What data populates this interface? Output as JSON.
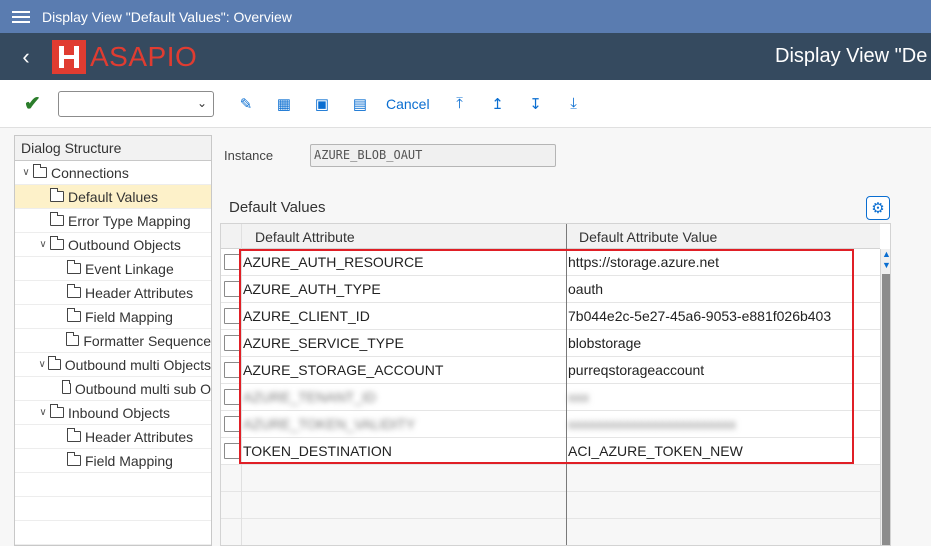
{
  "window": {
    "title": "Display View \"Default Values\": Overview"
  },
  "header": {
    "logo_text": "ASAPIO",
    "page_title": "Display View \"De"
  },
  "toolbar": {
    "cancel_label": "Cancel",
    "dropdown_value": ""
  },
  "tree": {
    "title": "Dialog Structure",
    "items": [
      {
        "label": "Connections",
        "level": 0,
        "expanded": true
      },
      {
        "label": "Default Values",
        "level": 1,
        "selected": true
      },
      {
        "label": "Error Type Mapping",
        "level": 1
      },
      {
        "label": "Outbound  Objects",
        "level": 1,
        "expanded": true
      },
      {
        "label": "Event Linkage",
        "level": 2
      },
      {
        "label": "Header Attributes",
        "level": 2
      },
      {
        "label": "Field Mapping",
        "level": 2
      },
      {
        "label": "Formatter Sequence",
        "level": 2
      },
      {
        "label": "Outbound multi Objects",
        "level": 1,
        "expanded": true
      },
      {
        "label": "Outbound multi sub O",
        "level": 2
      },
      {
        "label": "Inbound Objects",
        "level": 1,
        "expanded": true
      },
      {
        "label": "Header Attributes",
        "level": 2
      },
      {
        "label": "Field Mapping",
        "level": 2
      }
    ]
  },
  "instance": {
    "label": "Instance",
    "value": "AZURE_BLOB_OAUT"
  },
  "section": {
    "title": "Default Values"
  },
  "table": {
    "columns": [
      "Default Attribute",
      "Default Attribute Value"
    ],
    "rows": [
      {
        "attribute": "AZURE_AUTH_RESOURCE",
        "value": "https://storage.azure.net"
      },
      {
        "attribute": "AZURE_AUTH_TYPE",
        "value": "oauth"
      },
      {
        "attribute": "AZURE_CLIENT_ID",
        "value": "7b044e2c-5e27-45a6-9053-e881f026b403"
      },
      {
        "attribute": "AZURE_SERVICE_TYPE",
        "value": "blobstorage"
      },
      {
        "attribute": "AZURE_STORAGE_ACCOUNT",
        "value": "purreqstorageaccount"
      },
      {
        "attribute": "AZURE_TENANT_ID",
        "value": "xxx"
      },
      {
        "attribute": "AZURE_TOKEN_VALIDITY",
        "value": "xxxxxxxxxxxxxxxxxxxxxxxx"
      },
      {
        "attribute": "TOKEN_DESTINATION",
        "value": "ACI_AZURE_TOKEN_NEW"
      }
    ]
  },
  "colors": {
    "titlebar": "#5a7cb0",
    "header": "#354a5f",
    "brand": "#e03c31",
    "accent": "#0a6ed1",
    "highlight": "#e01f26"
  }
}
